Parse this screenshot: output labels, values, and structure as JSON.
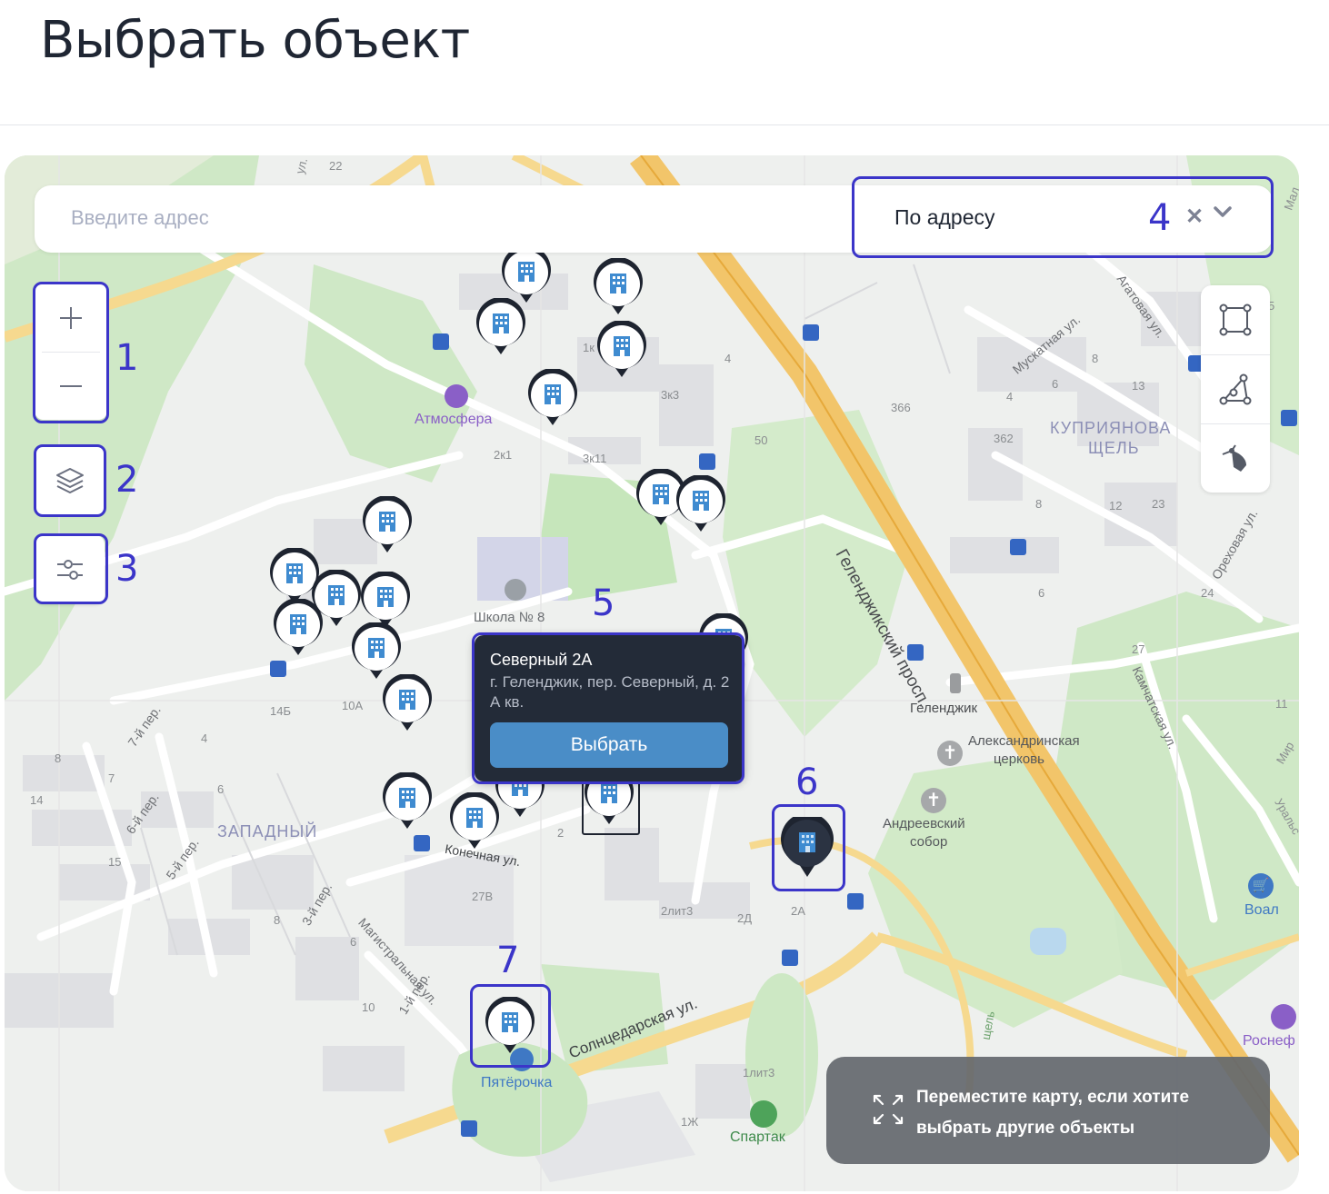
{
  "page": {
    "title": "Выбрать объект"
  },
  "search": {
    "placeholder": "Введите адрес",
    "mode_label": "По адресу"
  },
  "controls": {
    "zoom_in": "+",
    "zoom_out": "−"
  },
  "annotations": [
    "1",
    "2",
    "3",
    "4",
    "5",
    "6",
    "7"
  ],
  "popup": {
    "title": "Северный 2А",
    "address": "г. Геленджик, пер. Северный, д. 2 А кв.",
    "select_button": "Выбрать"
  },
  "hint": {
    "text": "Переместите карту, если хотите выбрать другие объекты"
  },
  "map": {
    "labels": {
      "atmosfera": "Атмосфера",
      "school": "Школа № 8",
      "prospect": "Геленджикский просп.",
      "kupriyanova": "КУПРИЯНОВА",
      "shchel": "ЩЕЛЬ",
      "zapadny": "ЗАПАДНЫЙ",
      "gelendzhik": "Геленджик",
      "church1": "Александринская",
      "church1b": "церковь",
      "church2": "Андреевский",
      "church2b": "собор",
      "voal": "Воал",
      "rosneft": "Роснеф",
      "pyaterochka": "Пятёрочка",
      "spartak": "Спартак",
      "konechnaya": "Конечная ул.",
      "solntsedarskaya": "Солнцедарская ул.",
      "magistralnaya": "Магистральная ул.",
      "muskatnaya": "Мускатная ул.",
      "agatovaya": "Агатовая ул.",
      "orekhovaya": "Ореховая ул.",
      "kamchatskaya": "Камчатская ул.",
      "per1": "1-й пер.",
      "per3": "3-й пер.",
      "per5": "5-й пер.",
      "per6": "6-й пер.",
      "per7": "7-й пер.",
      "ul_top": "ул.",
      "num_22": "22",
      "num_1k": "1к",
      "num_4": "4",
      "num_3k3": "3к3",
      "num_2k1": "2к1",
      "num_3k11": "3к11",
      "num_50": "50",
      "num_366": "366",
      "num_362": "362",
      "num_8a": "8",
      "num_6a": "6",
      "num_13": "13",
      "num_4b": "4",
      "num_12": "12",
      "num_23": "23",
      "num_24": "24",
      "num_27": "27",
      "num_11": "11",
      "num_14b": "14Б",
      "num_10a": "10А",
      "num_8b": "8",
      "num_7": "7",
      "num_14": "14",
      "num_15": "15",
      "num_6b": "6",
      "num_4c": "4",
      "num_27v": "27В",
      "num_2lit3": "2лит3",
      "num_2d": "2Д",
      "num_2a": "2А",
      "num_2": "2",
      "num_10": "10",
      "num_8c": "8",
      "num_6c": "6",
      "num_1lit3": "1лит3",
      "num_1zh": "1Ж",
      "num_5": "5",
      "num_8d": "8",
      "num_6d": "6",
      "mal": "Мал",
      "mir": "Мир",
      "ural": "Уральс",
      "shchel_small": "щель"
    }
  },
  "colors": {
    "accent": "#3b35c9",
    "button": "#4a8dc7",
    "popup_bg": "#232b38",
    "road_main": "#f2c56a",
    "green": "#c9e7c0"
  }
}
